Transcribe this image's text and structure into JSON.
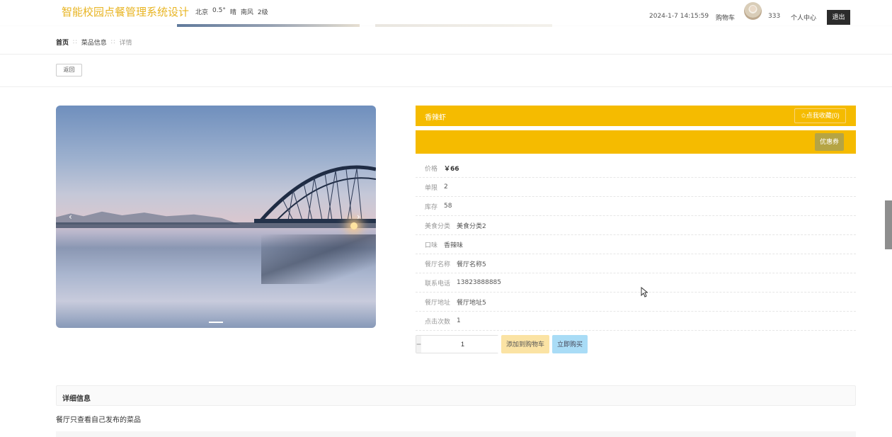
{
  "header": {
    "site_title": "智能校园点餐管理系统设计",
    "weather": {
      "city": "北京",
      "temp": "0.5°",
      "condition": "晴",
      "wind": "南风",
      "level": "2级"
    },
    "datetime": "2024-1-7 14:15:59",
    "cart_label": "购物车",
    "username": "333",
    "profile_label": "个人中心",
    "logout_label": "退出"
  },
  "breadcrumb": {
    "home": "首页",
    "section": "菜品信息",
    "current": "详情"
  },
  "back_label": "返回",
  "product": {
    "name": "香辣虾",
    "favorite_label": "✩点我收藏(0)",
    "coupon_label": "优惠券",
    "fields": [
      {
        "label": "价格",
        "value": "￥66"
      },
      {
        "label": "单限",
        "value": "2"
      },
      {
        "label": "库存",
        "value": "58"
      },
      {
        "label": "美食分类",
        "value": "美食分类2"
      },
      {
        "label": "口味",
        "value": "香辣味"
      },
      {
        "label": "餐厅名称",
        "value": "餐厅名称5"
      },
      {
        "label": "联系电话",
        "value": "13823888885"
      },
      {
        "label": "餐厅地址",
        "value": "餐厅地址5"
      },
      {
        "label": "点击次数",
        "value": "1"
      }
    ],
    "quantity": "1",
    "minus": "−",
    "plus": "+",
    "add_cart_label": "添加到购物车",
    "buy_now_label": "立即购买"
  },
  "carousel": {
    "prev": "‹",
    "next": "›"
  },
  "detail": {
    "heading": "详细信息",
    "text": "餐厅只查看自己发布的菜品"
  },
  "colors": {
    "accent": "#f5bb00",
    "title": "#e8b422"
  }
}
